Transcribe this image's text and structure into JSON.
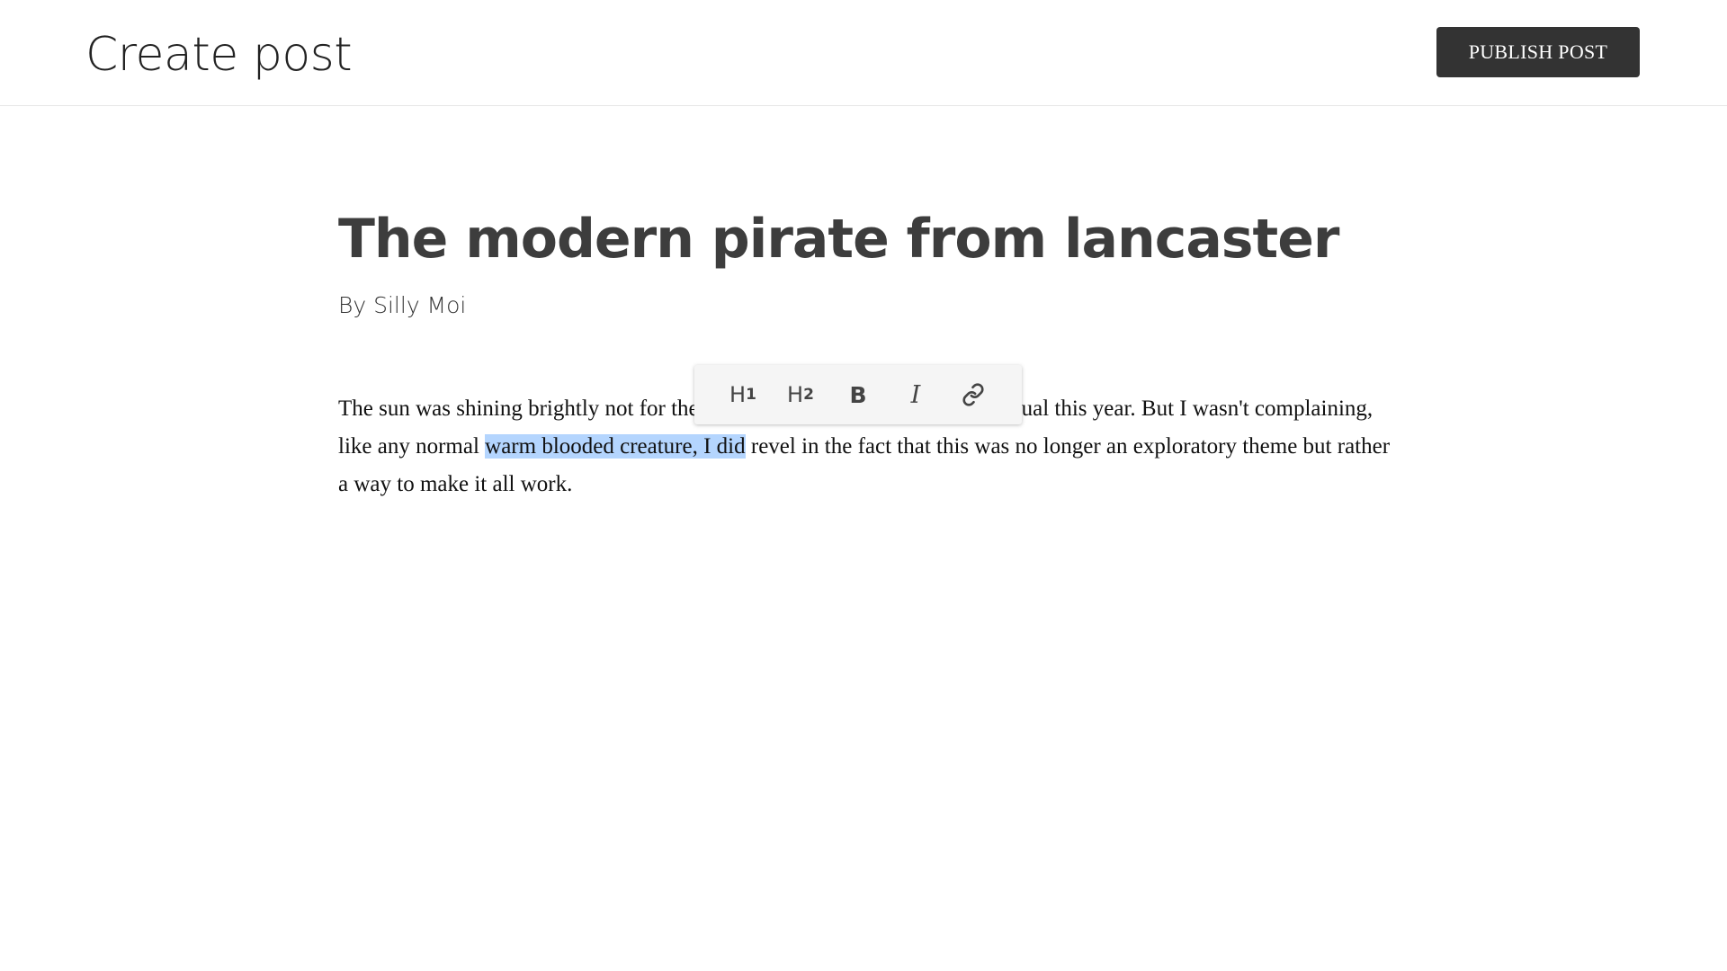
{
  "header": {
    "title": "Create post",
    "publish_label": "PUBLISH POST"
  },
  "article": {
    "title": "The modern pirate from lancaster",
    "byline": "By Silly Moi",
    "body": {
      "before_selection": "The sun was shining brightly not for the first time, the winter was a bit unusual this year. But I wasn't complaining, like any normal ",
      "selection": "warm blooded creature, I did",
      "after_selection": " revel in the fact that this was no longer an exploratory theme but rather a way to make it all work."
    }
  },
  "toolbar": {
    "h1_label": "H",
    "h1_sub": "1",
    "h2_label": "H",
    "h2_sub": "2",
    "bold_label": "B",
    "italic_label": "I",
    "link_icon": "link-icon"
  },
  "colors": {
    "publish_button_bg": "#333333",
    "selection_highlight": "#b4d5fe",
    "title_text": "#3d3d3d"
  }
}
